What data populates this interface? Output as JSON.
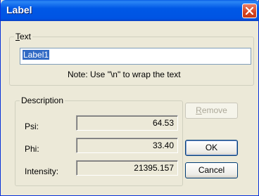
{
  "window": {
    "title": "Label"
  },
  "text_group": {
    "legend_underlined": "T",
    "legend_rest": "ext",
    "value": "Label1",
    "note": "Note: Use \"\\n\" to wrap the text"
  },
  "description_group": {
    "legend": "Description",
    "fields": [
      {
        "label": "Psi:",
        "value": "64.53"
      },
      {
        "label": "Phi:",
        "value": "33.40"
      },
      {
        "label": "Intensity:",
        "value": "21395.157"
      }
    ]
  },
  "buttons": {
    "remove_underlined": "R",
    "remove_rest": "emove",
    "ok": "OK",
    "cancel": "Cancel"
  },
  "colors": {
    "titlebar": "#0054e3",
    "dialog_bg": "#ece9d8",
    "selection": "#316ac5",
    "close_button": "#d4431f"
  }
}
